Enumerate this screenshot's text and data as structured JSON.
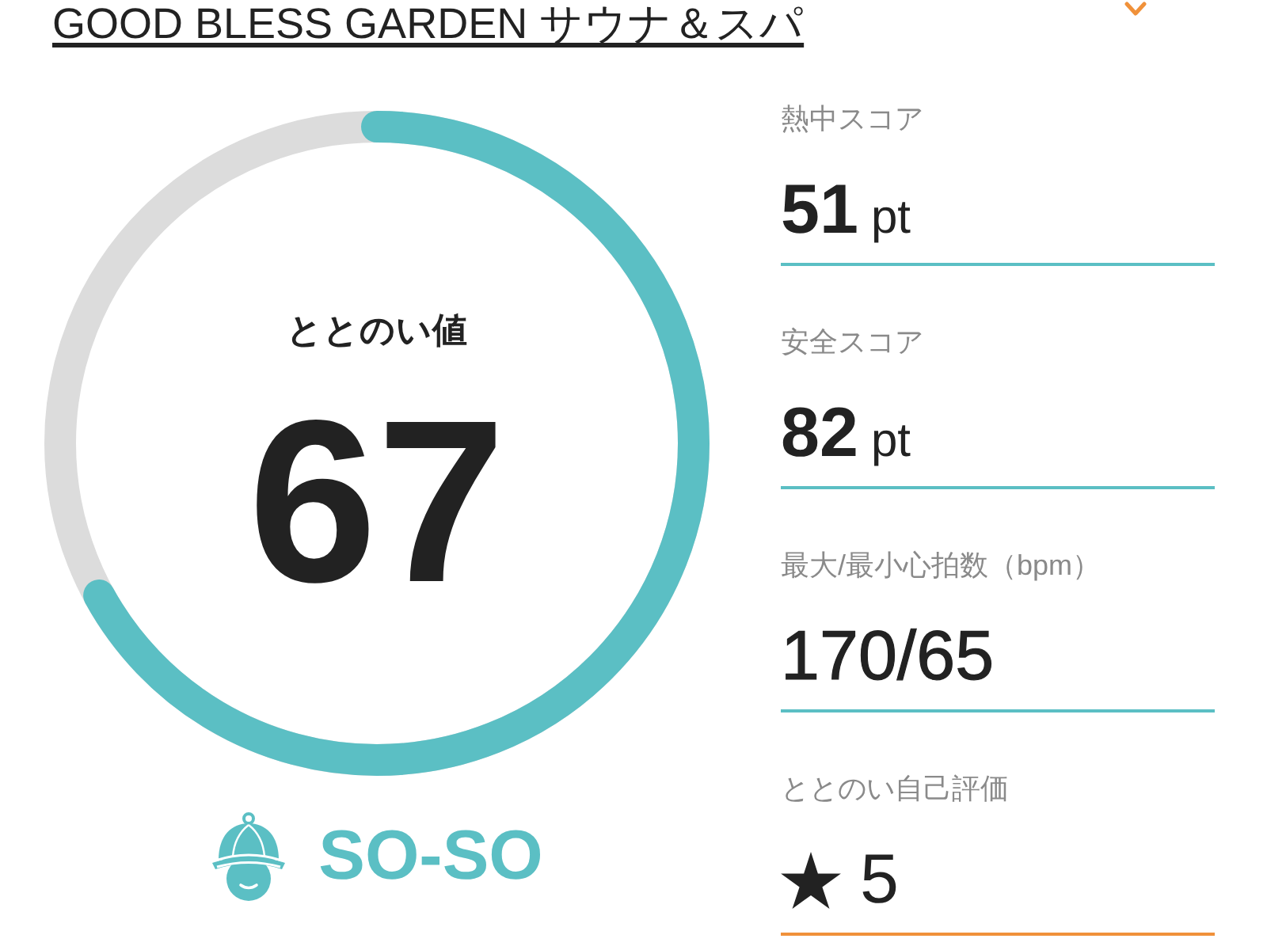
{
  "header": {
    "title": "GOOD BLESS GARDEN サウナ＆スパ"
  },
  "gauge": {
    "label": "ととのい値",
    "value": "67",
    "level": 0.67
  },
  "status": {
    "label": "SO-SO"
  },
  "metrics": [
    {
      "kind": "score",
      "label": "熱中スコア",
      "value": "51",
      "unit": "pt",
      "color": "#5bbfc4"
    },
    {
      "kind": "score",
      "label": "安全スコア",
      "value": "82",
      "unit": "pt",
      "color": "#5bbfc4"
    },
    {
      "kind": "plain",
      "label": "最大/最小心拍数（bpm）",
      "value": "170/65",
      "color": "#5bbfc4"
    },
    {
      "kind": "rating",
      "label": "ととのい自己評価",
      "value": "5",
      "color": "#f0913a"
    }
  ]
}
